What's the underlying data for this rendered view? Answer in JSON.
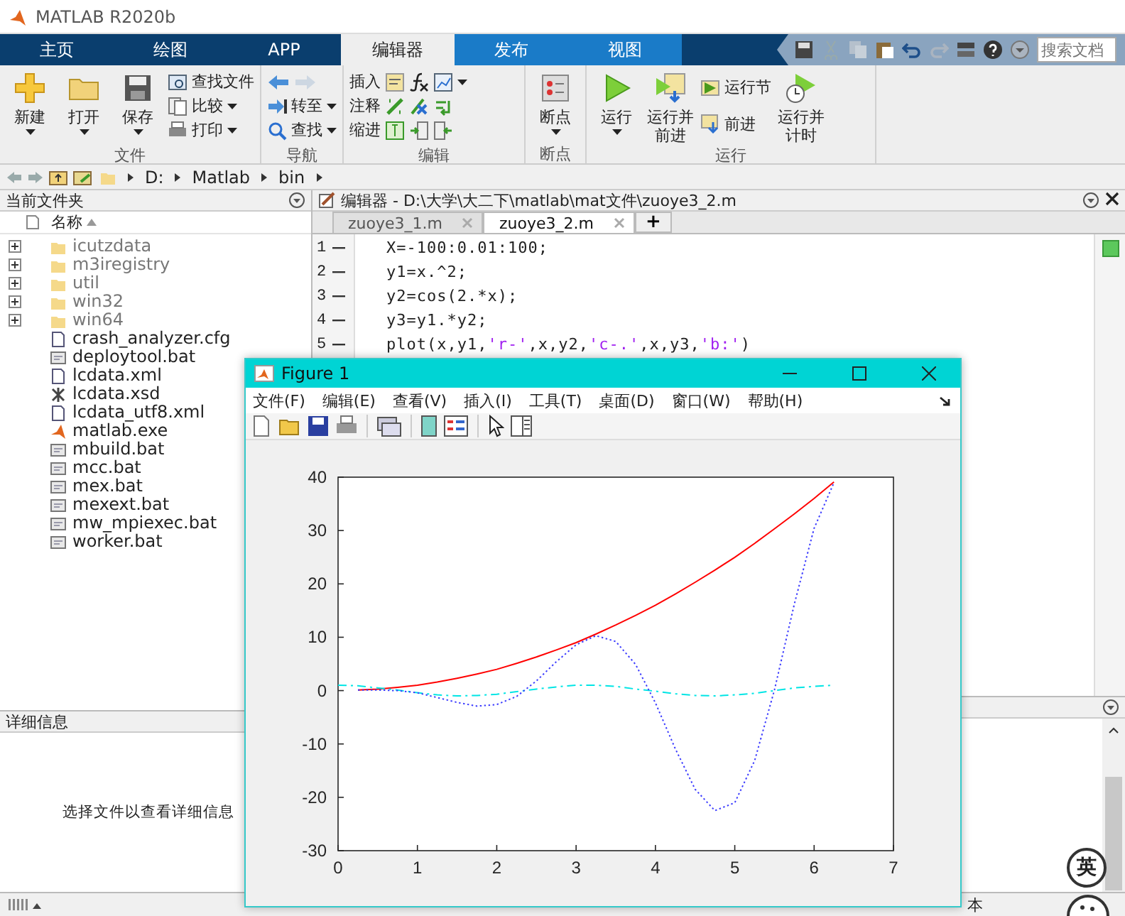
{
  "window": {
    "title": "MATLAB R2020b"
  },
  "ribbon_tabs": [
    {
      "label": "主页",
      "selected": false
    },
    {
      "label": "绘图",
      "selected": false
    },
    {
      "label": "APP",
      "selected": false
    },
    {
      "label": "编辑器",
      "selected": true
    },
    {
      "label": "发布",
      "selected": false
    },
    {
      "label": "视图",
      "selected": false
    }
  ],
  "quick_access": {
    "search": {
      "placeholder": "搜索文档"
    }
  },
  "ribbon_groups": [
    {
      "title": "文件",
      "items": [
        {
          "kind": "large",
          "label": "新建",
          "dropdown": true
        },
        {
          "kind": "large",
          "label": "打开",
          "dropdown": true
        },
        {
          "kind": "large",
          "label": "保存",
          "dropdown": true
        },
        {
          "kind": "stack",
          "items": [
            {
              "kind": "button",
              "label": "查找文件",
              "dropdown": false
            },
            {
              "kind": "button",
              "label": "比较",
              "dropdown": true
            },
            {
              "kind": "button",
              "label": "打印",
              "dropdown": true
            }
          ]
        }
      ]
    },
    {
      "title": "导航",
      "items": [
        {
          "kind": "stack",
          "items": [
            {
              "kind": "icons"
            },
            {
              "kind": "button",
              "label": "转至",
              "dropdown": true
            },
            {
              "kind": "button",
              "label": "查找",
              "dropdown": true
            }
          ]
        }
      ]
    },
    {
      "title": "编辑",
      "items": [
        {
          "kind": "stack",
          "items": [
            {
              "kind": "row",
              "label": "插入"
            },
            {
              "kind": "row",
              "label": "注释"
            },
            {
              "kind": "row",
              "label": "缩进"
            }
          ]
        }
      ]
    },
    {
      "title": "断点",
      "items": [
        {
          "kind": "large",
          "label": "断点",
          "dropdown": true
        }
      ]
    },
    {
      "title": "运行",
      "items": [
        {
          "kind": "large",
          "label": "运行",
          "dropdown": true
        },
        {
          "kind": "large",
          "label": "运行并前进",
          "dropdown": false
        },
        {
          "kind": "stack",
          "items": [
            {
              "kind": "button",
              "label": "运行节",
              "dropdown": false
            },
            {
              "kind": "button",
              "label": "前进",
              "dropdown": false
            }
          ]
        },
        {
          "kind": "large",
          "label": "运行并计时",
          "dropdown": false
        }
      ]
    }
  ],
  "address_bar": {
    "path": [
      "D:",
      "Matlab",
      "bin"
    ]
  },
  "current_folder": {
    "title": "当前文件夹",
    "column": "名称",
    "files": [
      {
        "kind": "folder",
        "name": "icutzdata"
      },
      {
        "kind": "folder",
        "name": "m3iregistry"
      },
      {
        "kind": "folder",
        "name": "util"
      },
      {
        "kind": "folder",
        "name": "win32"
      },
      {
        "kind": "folder",
        "name": "win64"
      },
      {
        "kind": "doc",
        "name": "crash_analyzer.cfg"
      },
      {
        "kind": "bat",
        "name": "deploytool.bat"
      },
      {
        "kind": "doc",
        "name": "lcdata.xml"
      },
      {
        "kind": "xsd",
        "name": "lcdata.xsd"
      },
      {
        "kind": "doc",
        "name": "lcdata_utf8.xml"
      },
      {
        "kind": "exe",
        "name": "matlab.exe"
      },
      {
        "kind": "bat",
        "name": "mbuild.bat"
      },
      {
        "kind": "bat",
        "name": "mcc.bat"
      },
      {
        "kind": "bat",
        "name": "mex.bat"
      },
      {
        "kind": "bat",
        "name": "mexext.bat"
      },
      {
        "kind": "bat",
        "name": "mw_mpiexec.bat"
      },
      {
        "kind": "bat",
        "name": "worker.bat"
      }
    ]
  },
  "details": {
    "title": "详细信息",
    "message": "选择文件以查看详细信息"
  },
  "editor": {
    "title": "编辑器 - D:\\大学\\大二下\\matlab\\mat文件\\zuoye3_2.m",
    "tabs": [
      {
        "label": "zuoye3_1.m",
        "selected": false
      },
      {
        "label": "zuoye3_2.m",
        "selected": true
      }
    ],
    "add_tab": "+",
    "lines": [
      {
        "number": "1",
        "tokens": [
          {
            "kind": "code",
            "text": "X=-100:0.01:100;"
          }
        ]
      },
      {
        "number": "2",
        "tokens": [
          {
            "kind": "code",
            "text": "y1=x.^2;"
          }
        ]
      },
      {
        "number": "3",
        "tokens": [
          {
            "kind": "code",
            "text": "y2=cos(2.*x);"
          }
        ]
      },
      {
        "number": "4",
        "tokens": [
          {
            "kind": "code",
            "text": "y3=y1.*y2;"
          }
        ]
      },
      {
        "number": "5",
        "tokens": [
          {
            "kind": "code",
            "text": "plot(x,y1,"
          },
          {
            "kind": "string",
            "text": "'r-'"
          },
          {
            "kind": "code",
            "text": ",x,y2,"
          },
          {
            "kind": "string",
            "text": "'c-.'"
          },
          {
            "kind": "code",
            "text": ",x,y3,"
          },
          {
            "kind": "string",
            "text": "'b:'"
          },
          {
            "kind": "code",
            "text": ")"
          }
        ]
      }
    ]
  },
  "status_bar": {
    "mode": "本"
  },
  "ime_badge": {
    "label": "英"
  },
  "figure": {
    "title": "Figure 1",
    "menus": [
      "文件(F)",
      "编辑(E)",
      "查看(V)",
      "插入(I)",
      "工具(T)",
      "桌面(D)",
      "窗口(W)",
      "帮助(H)"
    ],
    "chart_data": {
      "type": "line",
      "x": [
        0,
        0.25,
        0.5,
        0.75,
        1,
        1.25,
        1.5,
        1.75,
        2,
        2.25,
        2.5,
        2.75,
        3,
        3.25,
        3.5,
        3.75,
        4,
        4.25,
        4.5,
        4.75,
        5,
        5.25,
        5.5,
        5.75,
        6,
        6.25
      ],
      "xlim": [
        0,
        7
      ],
      "ylim": [
        -30,
        40
      ],
      "xticks": [
        0,
        1,
        2,
        3,
        4,
        5,
        6,
        7
      ],
      "yticks": [
        -30,
        -20,
        -10,
        0,
        10,
        20,
        30,
        40
      ],
      "series": [
        {
          "color": "#ff0000",
          "line_style": "solid",
          "values": [
            null,
            0.1,
            0.3,
            0.6,
            1,
            1.6,
            2.3,
            3.1,
            4,
            5.1,
            6.3,
            7.6,
            9,
            10.6,
            12.3,
            14.1,
            16,
            18.1,
            20.3,
            22.6,
            25,
            27.6,
            30.3,
            33.1,
            36,
            39.1
          ]
        },
        {
          "color": "#00e5e5",
          "line_style": "dash-dot",
          "values": [
            1,
            0.9,
            0.5,
            0.1,
            -0.4,
            -0.8,
            -1,
            -0.9,
            -0.7,
            -0.2,
            0.3,
            0.7,
            1,
            1,
            0.8,
            0.3,
            -0.1,
            -0.6,
            -0.9,
            -1,
            -0.8,
            -0.5,
            0,
            0.5,
            0.8,
            1
          ]
        },
        {
          "color": "#3c3cff",
          "line_style": "dotted",
          "values": [
            null,
            0.1,
            0.1,
            0,
            -0.4,
            -1.3,
            -2.2,
            -2.9,
            -2.6,
            -1.1,
            1.8,
            5.4,
            8.6,
            10.3,
            9.2,
            4.9,
            -2.3,
            -10.9,
            -18.5,
            -22.5,
            -21,
            -13.1,
            0.1,
            16.2,
            30.4,
            39
          ]
        }
      ]
    }
  }
}
